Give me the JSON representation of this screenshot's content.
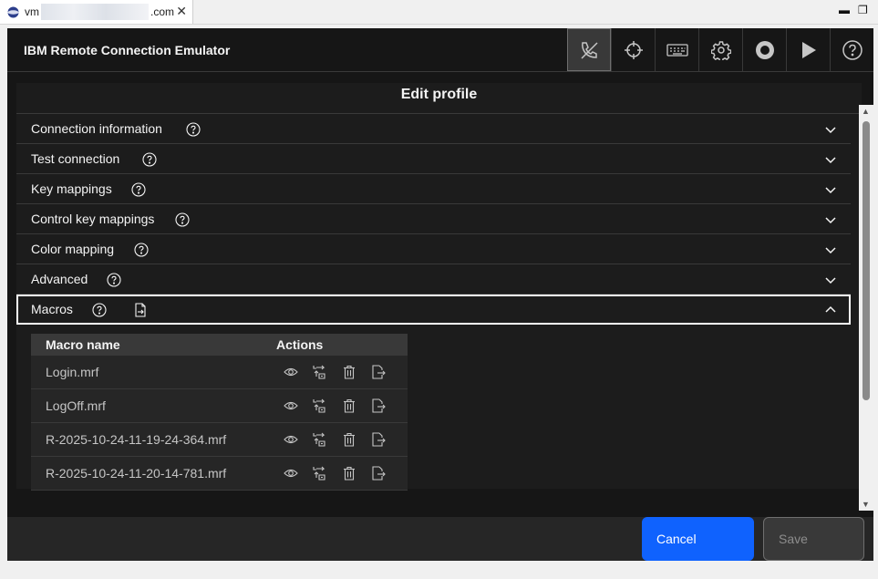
{
  "browser": {
    "tab_prefix": "vm",
    "tab_suffix": ".com",
    "close": "✕",
    "minimize": "▬",
    "restore": "❐"
  },
  "header": {
    "title": "IBM Remote Connection Emulator"
  },
  "panel": {
    "heading": "Edit profile",
    "sections": [
      {
        "label": "Connection information"
      },
      {
        "label": "Test connection"
      },
      {
        "label": "Key mappings"
      },
      {
        "label": "Control key mappings"
      },
      {
        "label": "Color mapping"
      },
      {
        "label": "Advanced"
      },
      {
        "label": "Macros"
      }
    ]
  },
  "macros": {
    "col_name": "Macro name",
    "col_actions": "Actions",
    "rows": [
      {
        "name": "Login.mrf"
      },
      {
        "name": "LogOff.mrf"
      },
      {
        "name": "R-2025-10-24-11-19-24-364.mrf"
      },
      {
        "name": "R-2025-10-24-11-20-14-781.mrf"
      }
    ]
  },
  "footer": {
    "cancel": "Cancel",
    "save": "Save"
  },
  "colors": {
    "primary": "#0f62fe",
    "background": "#161616"
  }
}
